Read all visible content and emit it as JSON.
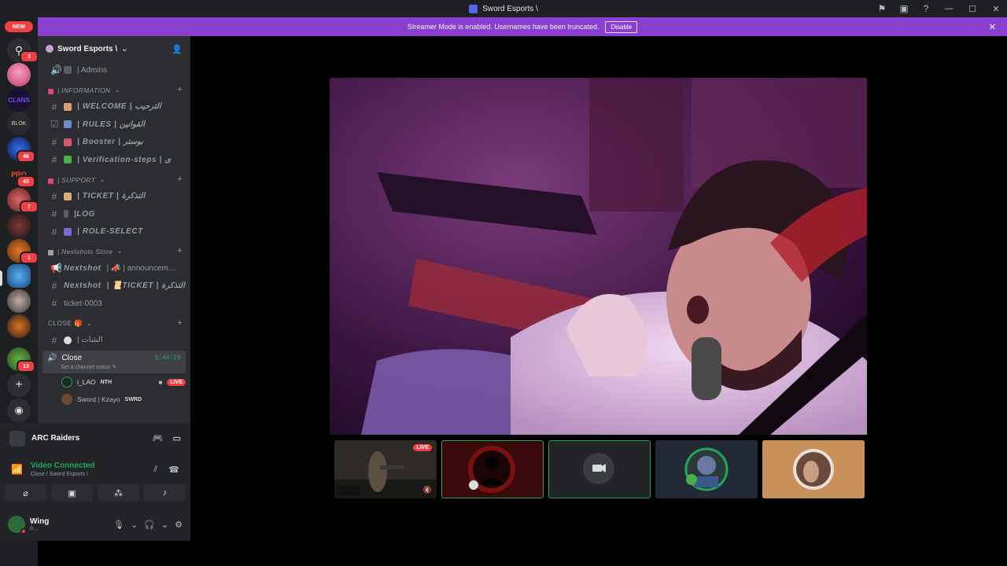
{
  "window": {
    "title": "Sword Esports \\"
  },
  "banner": {
    "text": "Streamer Mode is enabled. Usernames have been truncated.",
    "button": "Disable"
  },
  "rail": {
    "new_label": "NEW",
    "badges": [
      "3",
      "46",
      "43",
      "7",
      "1",
      "13"
    ]
  },
  "server": {
    "name": "Sword Esports \\",
    "admins": "| Admins"
  },
  "categories": {
    "information": "| INFORMATION",
    "support": "| SUPPORT",
    "store": "| Nextshots Store",
    "close": "CLOSE 🎁"
  },
  "channels": {
    "welcome": "| WELCOME | الترحيب",
    "rules": "| RULES | القوانين",
    "booster": "| Booster | بوستر",
    "verification": "| Verification-steps | ی",
    "ticket": "| TICKET | التذكرة",
    "log": "|LOG",
    "role_select": "| ROLE-SELECT",
    "announce_prefix": "Nextshot",
    "announce": "| 📣 | announcem…",
    "store_ticket_prefix": "Nextshot",
    "store_ticket": "| 📜TICKET | التذكرة",
    "ticket0003": "ticket-0003",
    "chat": "| الشات"
  },
  "voice": {
    "name": "Close",
    "timer": "1:44:29",
    "status": "Set a channel status",
    "members": [
      {
        "name": "i_LAO",
        "tag": "NTH",
        "live": "LIVE"
      },
      {
        "name": "Sword | Kzayo",
        "tag": "SWRD"
      }
    ]
  },
  "activity": {
    "name": "ARC Raiders"
  },
  "connection": {
    "status": "Video Connected",
    "location": "Close / Sword Esports \\"
  },
  "user": {
    "name": "Wing",
    "sub": "ó…"
  },
  "stage": {
    "thumbs": [
      {
        "live": "LIVE"
      }
    ]
  },
  "colors": {
    "banner": "#8a3fd1",
    "connected": "#23a55a",
    "live": "#f23f43"
  }
}
